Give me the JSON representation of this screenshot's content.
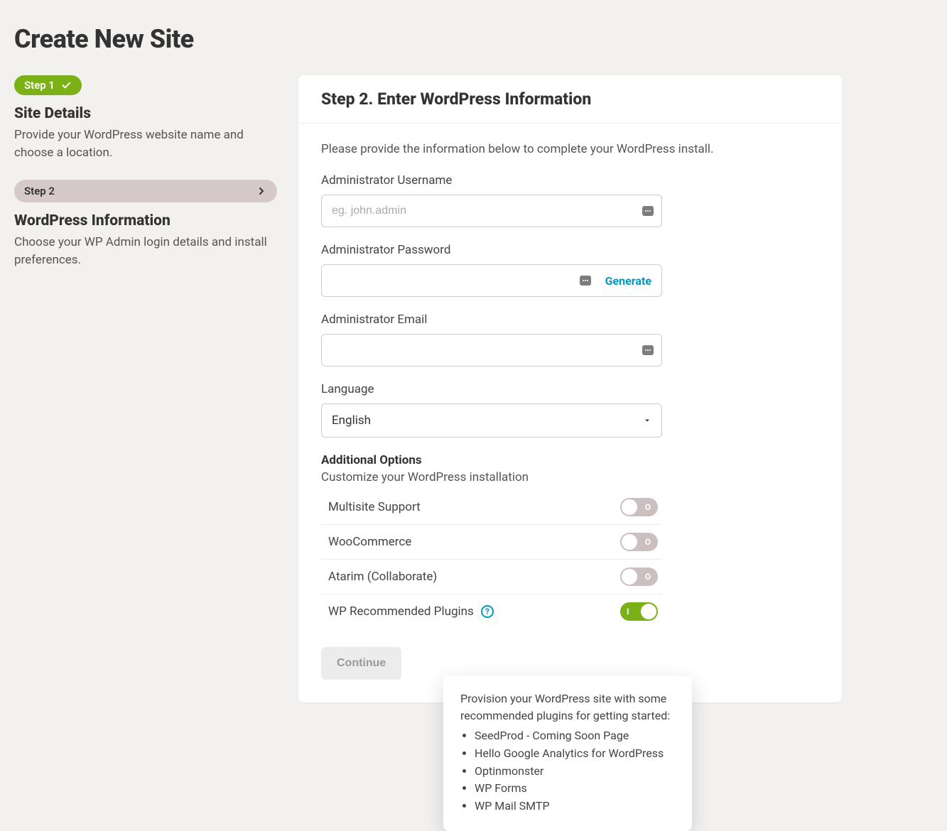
{
  "page": {
    "title": "Create New Site"
  },
  "sidebar": {
    "step1": {
      "pill": "Step 1",
      "title": "Site Details",
      "desc": "Provide your WordPress website name and choose a location."
    },
    "step2": {
      "pill": "Step 2",
      "title": "WordPress Information",
      "desc": "Choose your WP Admin login details and install preferences."
    }
  },
  "panel": {
    "heading": "Step 2. Enter WordPress Information",
    "intro": "Please provide the information below to complete your WordPress install.",
    "fields": {
      "username": {
        "label": "Administrator Username",
        "placeholder": "eg. john.admin",
        "value": ""
      },
      "password": {
        "label": "Administrator Password",
        "value": "",
        "generate": "Generate"
      },
      "email": {
        "label": "Administrator Email",
        "value": ""
      },
      "language": {
        "label": "Language",
        "value": "English"
      }
    },
    "additional": {
      "heading": "Additional Options",
      "sub": "Customize your WordPress installation",
      "options": [
        {
          "label": "Multisite Support",
          "on": false,
          "txt": "O"
        },
        {
          "label": "WooCommerce",
          "on": false,
          "txt": "O"
        },
        {
          "label": "Atarim (Collaborate)",
          "on": false,
          "txt": "O"
        },
        {
          "label": "WP Recommended Plugins",
          "on": true,
          "txt": "I",
          "help": true
        }
      ]
    },
    "continue": "Continue"
  },
  "tooltip": {
    "text": "Provision your WordPress site with some recommended plugins for getting started:",
    "items": [
      "SeedProd - Coming Soon Page",
      "Hello Google Analytics for WordPress",
      "Optinmonster",
      "WP Forms",
      "WP Mail SMTP"
    ]
  }
}
